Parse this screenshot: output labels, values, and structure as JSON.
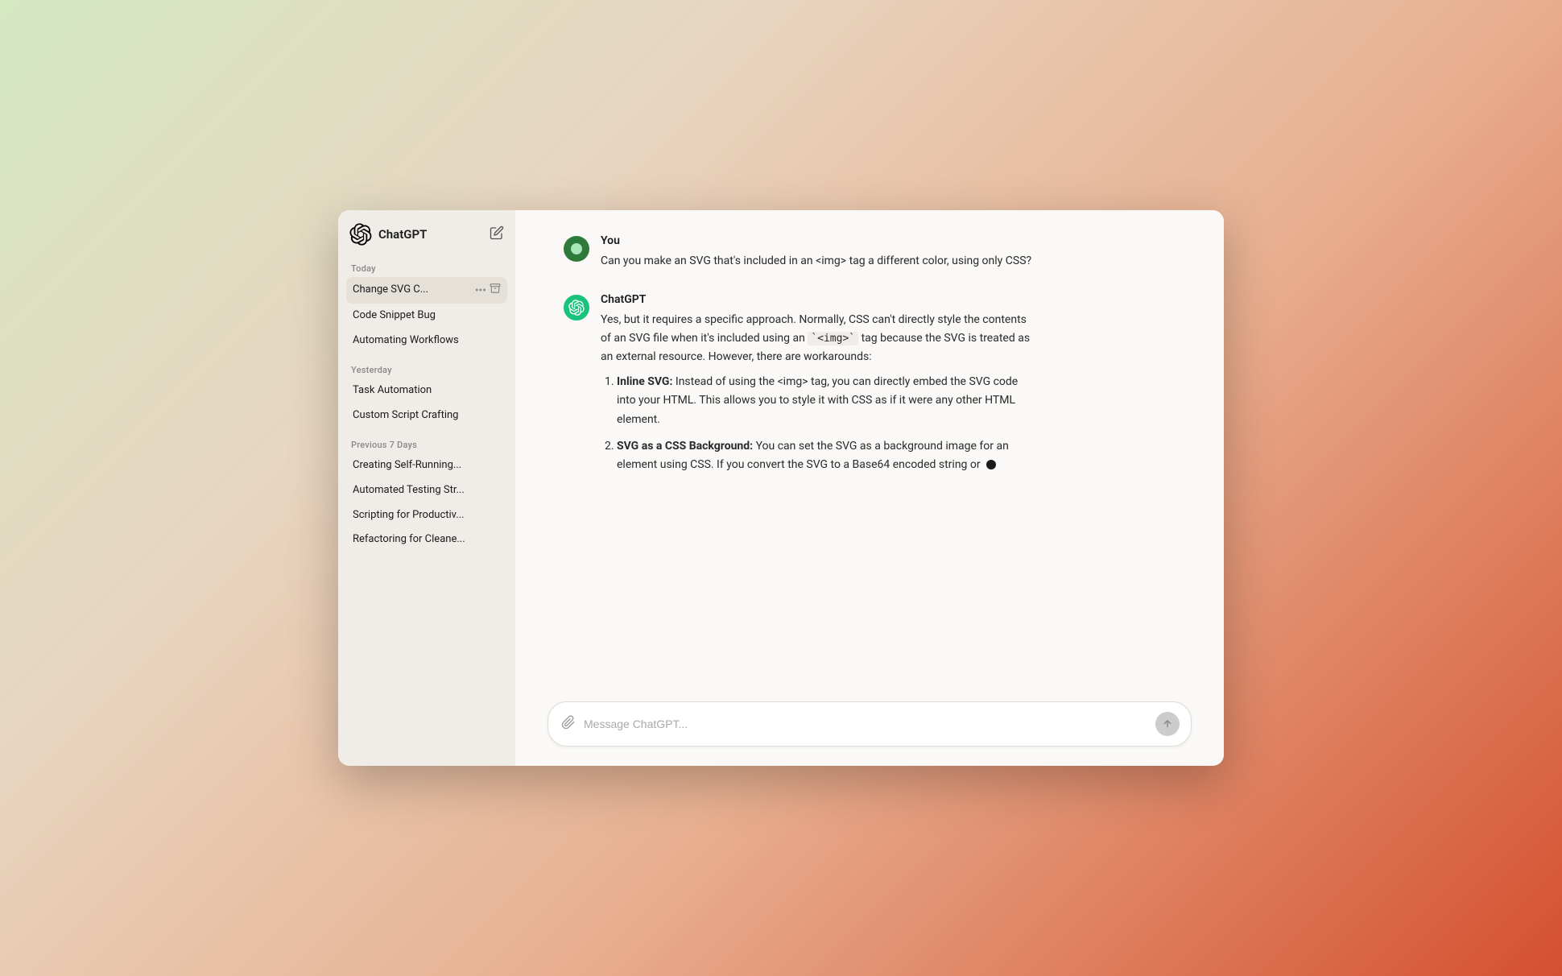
{
  "app": {
    "title": "ChatGPT",
    "new_chat_label": "New Chat"
  },
  "sidebar": {
    "sections": [
      {
        "label": "Today",
        "items": [
          {
            "id": "change-svg",
            "text": "Change SVG C...",
            "active": true,
            "show_actions": true
          },
          {
            "id": "code-snippet",
            "text": "Code Snippet Bug",
            "active": false
          },
          {
            "id": "automating",
            "text": "Automating Workflows",
            "active": false
          }
        ]
      },
      {
        "label": "Yesterday",
        "items": [
          {
            "id": "task-automation",
            "text": "Task Automation",
            "active": false
          },
          {
            "id": "custom-script",
            "text": "Custom Script Crafting",
            "active": false
          }
        ]
      },
      {
        "label": "Previous 7 Days",
        "items": [
          {
            "id": "creating-self",
            "text": "Creating Self-Running...",
            "active": false
          },
          {
            "id": "automated-testing",
            "text": "Automated Testing Str...",
            "active": false
          },
          {
            "id": "scripting-prod",
            "text": "Scripting for Productiv...",
            "active": false
          },
          {
            "id": "refactoring",
            "text": "Refactoring for Cleane...",
            "active": false
          }
        ]
      }
    ]
  },
  "conversation": {
    "messages": [
      {
        "id": "user-1",
        "role": "user",
        "author": "You",
        "text": "Can you make an SVG that's included in an <img> tag a different color, using only CSS?"
      },
      {
        "id": "gpt-1",
        "role": "assistant",
        "author": "ChatGPT",
        "intro": "Yes, but it requires a specific approach. Normally, CSS can't directly style the contents of an SVG file when it's included using an `<img>` tag because the SVG is treated as an external resource. However, there are workarounds:",
        "list_items": [
          {
            "title": "Inline SVG:",
            "body": "Instead of using the <img> tag, you can directly embed the SVG code into your HTML. This allows you to style it with CSS as if it were any other HTML element."
          },
          {
            "title": "SVG as a CSS Background:",
            "body": "You can set the SVG as a background image for an element using CSS. If you convert the SVG to a Base64 encoded string or"
          }
        ]
      }
    ]
  },
  "input": {
    "placeholder": "Message ChatGPT..."
  }
}
